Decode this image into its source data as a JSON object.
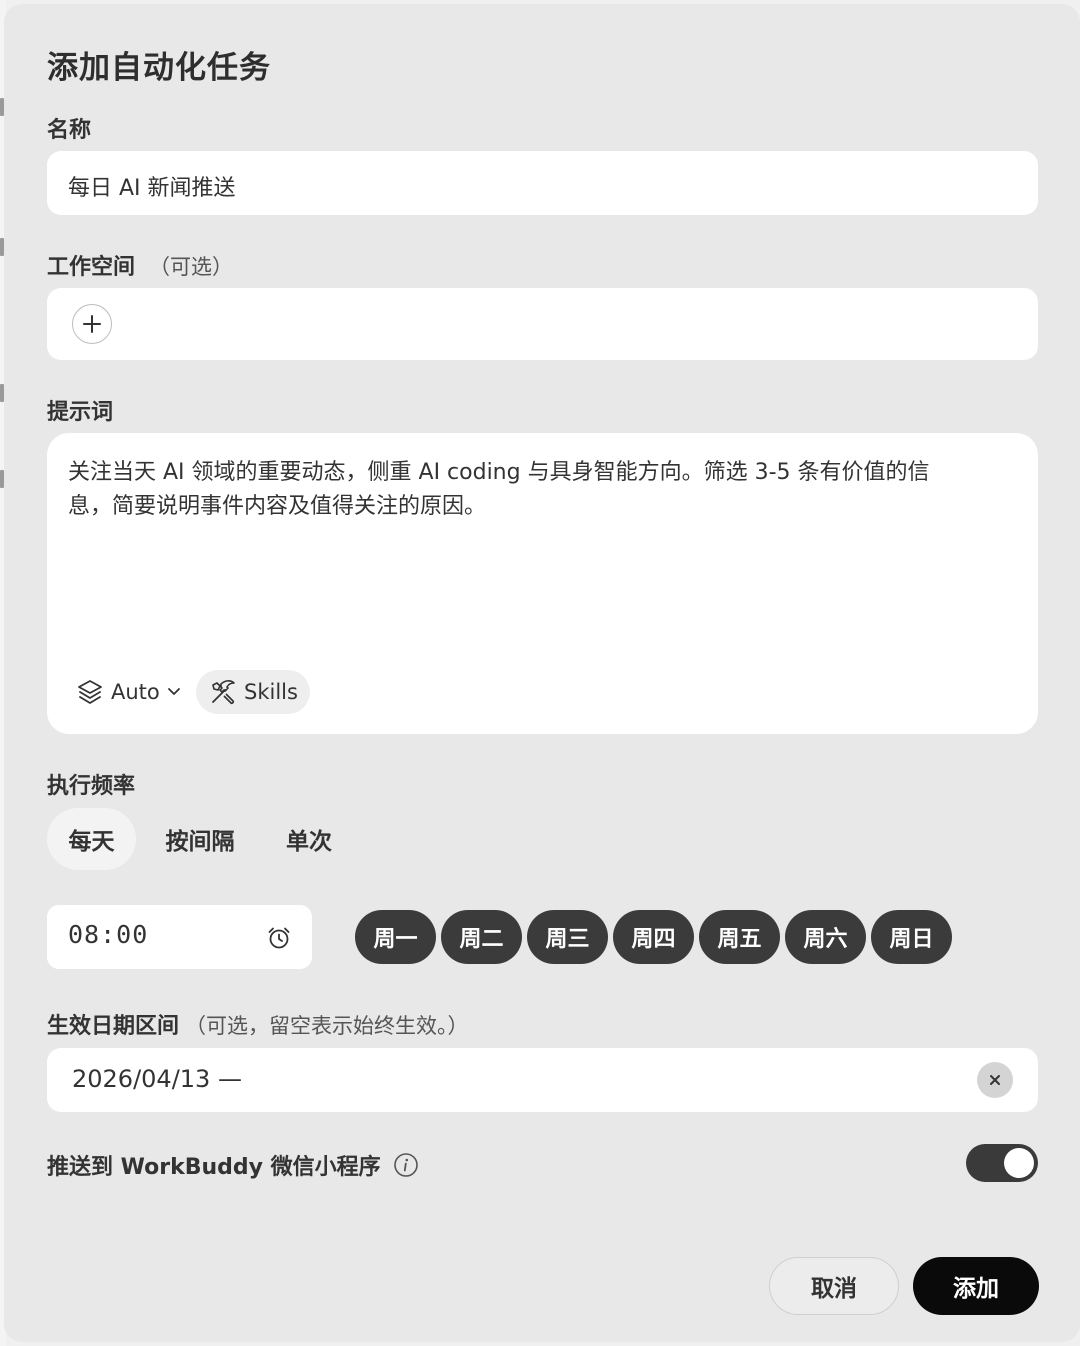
{
  "dialog": {
    "title": "添加自动化任务",
    "name": {
      "label": "名称",
      "value": "每日 AI 新闻推送"
    },
    "workspace": {
      "label": "工作空间",
      "hint": "（可选）",
      "add_icon": "plus-icon"
    },
    "prompt": {
      "label": "提示词",
      "value_line1": "关注当天 AI 领域的重要动态，侧重 AI coding 与具身智能方向。筛选 3-5 条有价值的信",
      "value_line2": "息，简要说明事件内容及值得关注的原因。",
      "model_label": "Auto",
      "model_icon": "layers-icon",
      "skills_label": "Skills",
      "skills_icon": "tools-icon"
    },
    "frequency": {
      "label": "执行频率",
      "tabs": [
        "每天",
        "按间隔",
        "单次"
      ],
      "active_tab": "每天",
      "time": "08:00",
      "time_icon": "alarm-clock-icon",
      "days": [
        "周一",
        "周二",
        "周三",
        "周四",
        "周五",
        "周六",
        "周日"
      ]
    },
    "date_range": {
      "label": "生效日期区间",
      "hint": "（可选，留空表示始终生效。）",
      "value": "2026/04/13 —",
      "clear_icon": "close-icon"
    },
    "push": {
      "label": "推送到 WorkBuddy 微信小程序",
      "info_icon": "info-icon",
      "enabled": true
    },
    "buttons": {
      "cancel": "取消",
      "add": "添加"
    }
  },
  "colors": {
    "modal_bg": "#e8e8e8",
    "field_bg": "#ffffff",
    "day_pill_bg": "#3b3b3b",
    "primary_button_bg": "#0a0a0a",
    "toggle_on_bg": "#3a3a3a"
  }
}
